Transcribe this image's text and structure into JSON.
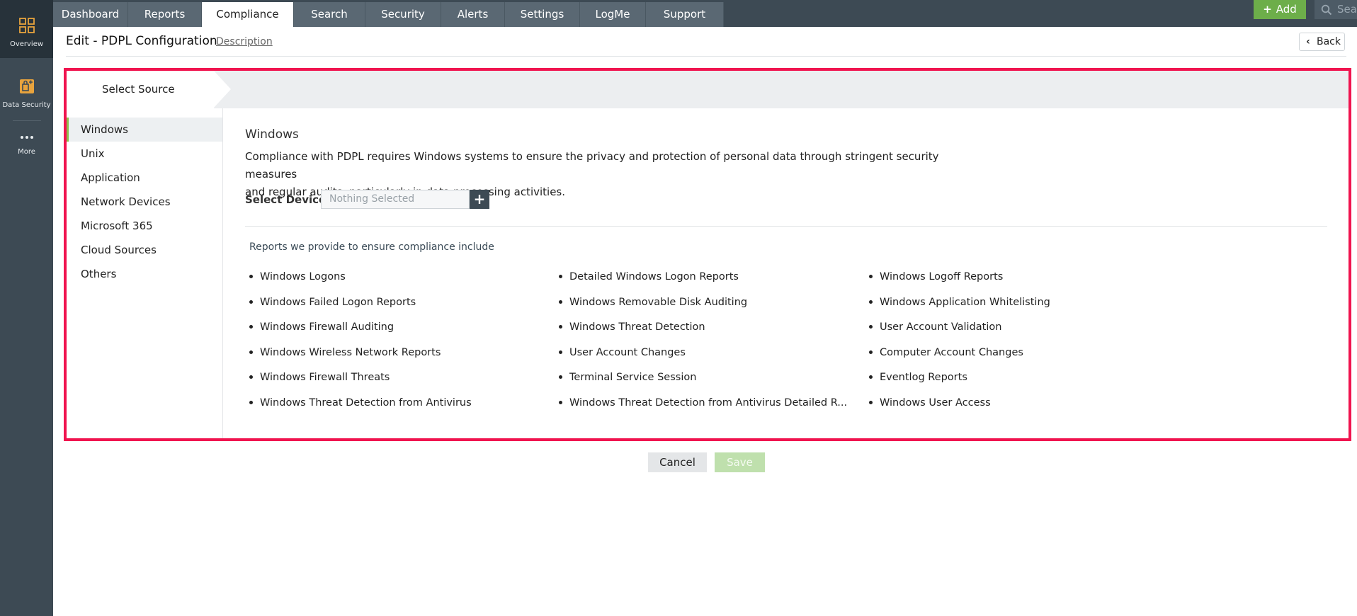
{
  "rail": {
    "overview_label": "Overview",
    "data_security_label": "Data Security",
    "more_label": "More"
  },
  "nav": {
    "tabs": [
      "Dashboard",
      "Reports",
      "Compliance",
      "Search",
      "Security",
      "Alerts",
      "Settings",
      "LogMe",
      "Support"
    ],
    "active_tab": "Compliance",
    "add_label": "Add",
    "search_placeholder": "Search"
  },
  "header": {
    "title": "Edit - PDPL Configuration",
    "description_link": "Description",
    "back_label": "Back"
  },
  "wizard": {
    "step_label": "Select Source"
  },
  "sources": [
    "Windows",
    "Unix",
    "Application",
    "Network Devices",
    "Microsoft 365",
    "Cloud Sources",
    "Others"
  ],
  "active_source": "Windows",
  "content": {
    "title": "Windows",
    "description_line1": "Compliance with PDPL requires Windows systems to ensure the privacy and protection of personal data through stringent security measures",
    "description_line2": "and regular audits, particularly in data processing activities.",
    "select_devices_label": "Select Devices",
    "select_devices_placeholder": "Nothing Selected",
    "reports_heading": "Reports we provide to ensure compliance include",
    "reports": [
      [
        "Windows Logons",
        "Detailed Windows Logon Reports",
        "Windows Logoff Reports"
      ],
      [
        "Windows Failed Logon Reports",
        "Windows Removable Disk Auditing",
        "Windows Application Whitelisting"
      ],
      [
        "Windows Firewall Auditing",
        "Windows Threat Detection",
        "User Account Validation"
      ],
      [
        "Windows Wireless Network Reports",
        "User Account Changes",
        "Computer Account Changes"
      ],
      [
        "Windows Firewall Threats",
        "Terminal Service Session",
        "Eventlog Reports"
      ],
      [
        "Windows Threat Detection from Antivirus",
        "Windows Threat Detection from Antivirus Detailed R...",
        "Windows User Access"
      ]
    ]
  },
  "footer": {
    "cancel_label": "Cancel",
    "save_label": "Save"
  },
  "colors": {
    "highlight_border": "#f0144f",
    "accent_green": "#6dae4a",
    "nav_dark": "#3d4a54"
  }
}
